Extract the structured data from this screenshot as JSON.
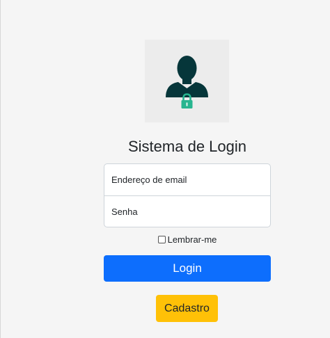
{
  "logo": {
    "icon": "user-lock-icon",
    "colors": {
      "figure": "#06363a",
      "lock": "#27b58f"
    }
  },
  "title": "Sistema de Login",
  "form": {
    "email_placeholder": "Endereço de email",
    "password_placeholder": "Senha",
    "remember_label": "Lembrar-me",
    "remember_checked": false
  },
  "buttons": {
    "login_label": "Login",
    "register_label": "Cadastro"
  },
  "colors": {
    "background": "#f5f5f5",
    "primary": "#0d6efd",
    "warning": "#ffc107"
  }
}
